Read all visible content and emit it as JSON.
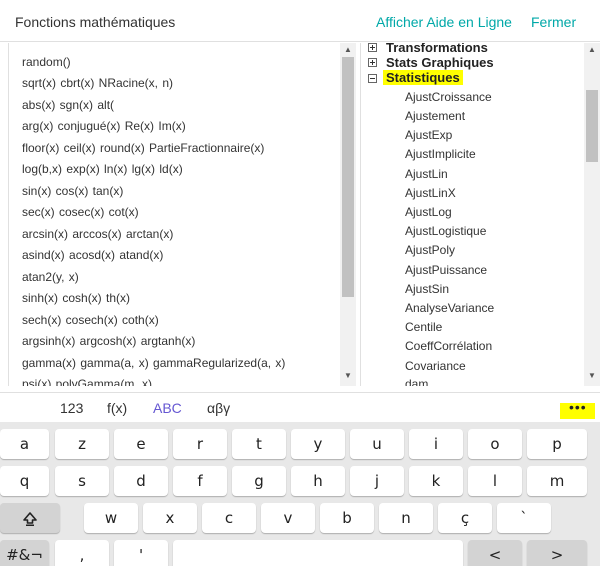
{
  "header": {
    "title": "Fonctions mathématiques",
    "help": "Afficher Aide en Ligne",
    "close": "Fermer"
  },
  "functions": [
    "random()",
    "sqrt(x)  cbrt(x)  NRacine(x, n)",
    "abs(x)  sgn(x)  alt(",
    "arg(x)  conjugué(x)  Re(x)  Im(x)",
    "floor(x)  ceil(x)  round(x)  PartieFractionnaire(x)",
    "log(b,x)  exp(x)  ln(x)  lg(x)  ld(x)",
    "sin(x)  cos(x)  tan(x)",
    "sec(x)  cosec(x)  cot(x)",
    "arcsin(x)  arccos(x)  arctan(x)",
    "asind(x)  acosd(x)  atand(x)",
    "atan2(y, x)",
    "sinh(x)  cosh(x)  th(x)",
    "sech(x)  cosech(x)  coth(x)",
    "argsinh(x)  argcosh(x)  argtanh(x)",
    "gamma(x)  gamma(a, x)  gammaRegularized(a, x)",
    "psi(x)  polyGamma(m, x)"
  ],
  "tree": {
    "categories": [
      {
        "label": "Transformations",
        "expanded": false
      },
      {
        "label": "Stats Graphiques",
        "expanded": false
      },
      {
        "label": "Statistiques",
        "expanded": true
      }
    ],
    "commands": [
      "AjustCroissance",
      "Ajustement",
      "AjustExp",
      "AjustImplicite",
      "AjustLin",
      "AjustLinX",
      "AjustLog",
      "AjustLogistique",
      "AjustPoly",
      "AjustPuissance",
      "AjustSin",
      "AnalyseVariance",
      "Centile",
      "CoeffCorrélation",
      "Covariance",
      "dam"
    ]
  },
  "keyboard": {
    "tabs": [
      "123",
      "f(x)",
      "ABC",
      "αβγ"
    ],
    "active_tab": "ABC",
    "more": "•••",
    "rows": [
      [
        "a",
        "z",
        "e",
        "r",
        "t",
        "y",
        "u",
        "i",
        "o",
        "p"
      ],
      [
        "q",
        "s",
        "d",
        "f",
        "g",
        "h",
        "j",
        "k",
        "l",
        "m"
      ],
      [
        "w",
        "x",
        "c",
        "v",
        "b",
        "n",
        "ç",
        "`"
      ],
      [
        "#&¬",
        ",",
        "'",
        "<",
        ">"
      ]
    ],
    "shift_icon": "shift-icon"
  },
  "colors": {
    "accent": "#00a8a8",
    "active_tab": "#6557d2",
    "highlight": "#ffff00"
  }
}
